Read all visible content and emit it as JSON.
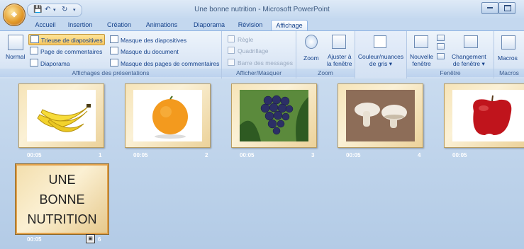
{
  "window": {
    "title": "Une bonne nutrition - Microsoft PowerPoint"
  },
  "tabs": [
    "Accueil",
    "Insertion",
    "Création",
    "Animations",
    "Diaporama",
    "Révision",
    "Affichage"
  ],
  "active_tab": "Affichage",
  "ribbon": {
    "groups": {
      "presentation": {
        "label": "Affichages des présentations",
        "normal": "Normal",
        "trieuse": "Trieuse de diapositives",
        "page_commentaires": "Page de commentaires",
        "diaporama": "Diaporama",
        "masque_diapositives": "Masque des diapositives",
        "masque_document": "Masque du document",
        "masque_commentaires": "Masque des pages de commentaires"
      },
      "afficher": {
        "label": "Afficher/Masquer",
        "regle": "Règle",
        "quadrillage": "Quadrillage",
        "barre_messages": "Barre des messages"
      },
      "zoom": {
        "label": "Zoom",
        "zoom": "Zoom",
        "ajuster1": "Ajuster à",
        "ajuster2": "la fenêtre"
      },
      "couleur": {
        "line1": "Couleur/nuances",
        "line2": "de gris"
      },
      "fenetre": {
        "label": "Fenêtre",
        "nouvelle1": "Nouvelle",
        "nouvelle2": "fenêtre",
        "changement1": "Changement",
        "changement2": "de fenêtre"
      },
      "macros": {
        "label": "Macros",
        "macros": "Macros"
      }
    }
  },
  "slides": [
    {
      "time": "00:05",
      "number": "1",
      "image": "bananas"
    },
    {
      "time": "00:05",
      "number": "2",
      "image": "orange"
    },
    {
      "time": "00:05",
      "number": "3",
      "image": "grapes"
    },
    {
      "time": "00:05",
      "number": "4",
      "image": "mushrooms"
    },
    {
      "time": "00:05",
      "number": "",
      "image": "apple"
    },
    {
      "time": "00:05",
      "number": "6",
      "title_lines": [
        "UNE",
        "BONNE",
        "NUTRITION"
      ]
    }
  ],
  "colors": {
    "ribbon": "#dde8f6",
    "sorter_bg": "#b9d1ea",
    "selected": "#f8c760"
  }
}
